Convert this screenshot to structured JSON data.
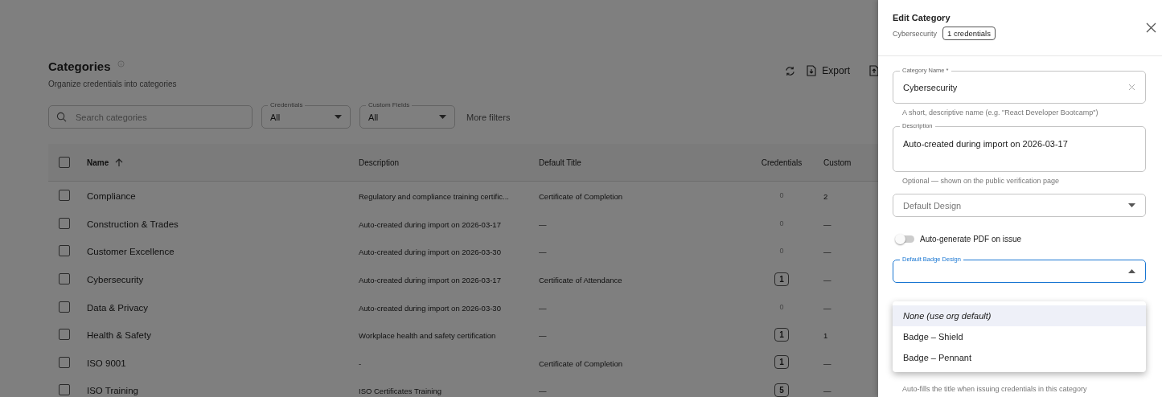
{
  "page": {
    "title": "Categories",
    "subtitle": "Organize credentials into categories",
    "toolbar": {
      "export": "Export"
    },
    "search": {
      "placeholder": "Search categories"
    },
    "filters": [
      {
        "label": "Credentials",
        "value": "All"
      },
      {
        "label": "Custom Fields",
        "value": "All"
      }
    ],
    "more_filters": "More filters"
  },
  "table": {
    "select_all": {
      "checked": false
    },
    "columns": [
      {
        "label": "Name",
        "sorted": true
      },
      {
        "label": "Description",
        "sorted": false
      },
      {
        "label": "Default Title",
        "sorted": false
      },
      {
        "label": "Credentials",
        "sorted": false
      },
      {
        "label": "Custom",
        "sorted": false
      }
    ],
    "rows": [
      {
        "checked": false,
        "name": "Compliance",
        "description": "Regulatory and compliance training certific...",
        "default_title": "Certificate of Completion",
        "credentials": "0",
        "boxed": false,
        "custom": "2"
      },
      {
        "checked": false,
        "name": "Construction & Trades",
        "description": "Auto-created during import on 2026-03-17",
        "default_title": "—",
        "credentials": "0",
        "boxed": false,
        "custom": "—"
      },
      {
        "checked": false,
        "name": "Customer Excellence",
        "description": "Auto-created during import on 2026-03-30",
        "default_title": "—",
        "credentials": "0",
        "boxed": false,
        "custom": "—"
      },
      {
        "checked": false,
        "name": "Cybersecurity",
        "description": "Auto-created during import on 2026-03-17",
        "default_title": "Certificate of Attendance",
        "credentials": "1",
        "boxed": true,
        "custom": "—"
      },
      {
        "checked": false,
        "name": "Data & Privacy",
        "description": "Auto-created during import on 2026-03-30",
        "default_title": "—",
        "credentials": "0",
        "boxed": false,
        "custom": "—"
      },
      {
        "checked": false,
        "name": "Health & Safety",
        "description": "Workplace health and safety certification",
        "default_title": "—",
        "credentials": "1",
        "boxed": true,
        "custom": "1"
      },
      {
        "checked": false,
        "name": "ISO 9001",
        "description": "-",
        "default_title": "Certificate of Completion",
        "credentials": "1",
        "boxed": true,
        "custom": "—"
      },
      {
        "checked": false,
        "name": "ISO Training",
        "description": "ISO Certificates Training",
        "default_title": "—",
        "credentials": "5",
        "boxed": true,
        "custom": "—"
      }
    ]
  },
  "drawer": {
    "title": "Edit Category",
    "subtitle": "Cybersecurity",
    "count_badge": "1 credentials",
    "category_name": {
      "label": "Category Name *",
      "value": "Cybersecurity",
      "helper": "A short, descriptive name (e.g. \"React Developer Bootcamp\")"
    },
    "description": {
      "label": "Description",
      "value": "Auto-created during import on 2026-03-17",
      "helper": "Optional — shown on the public verification page"
    },
    "default_design": {
      "placeholder": "Default Design"
    },
    "auto_pdf": {
      "label": "Auto-generate PDF on issue",
      "on": false
    },
    "badge_design": {
      "label": "Default Badge Design",
      "expanded": true,
      "options": [
        {
          "label": "None (use org default)",
          "kind": "none",
          "selected": true
        },
        {
          "label": "Badge – Shield",
          "kind": "design",
          "selected": false
        },
        {
          "label": "Badge – Pennant",
          "kind": "design",
          "selected": false
        }
      ]
    },
    "default_title_helper": "Auto-fills the title when issuing credentials in this category"
  }
}
